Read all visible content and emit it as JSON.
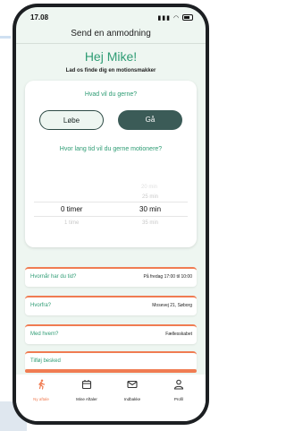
{
  "status": {
    "time": "17.08"
  },
  "header": {
    "title": "Send en anmodning"
  },
  "greeting": "Hej Mike!",
  "subtitle": "Lad os finde dig en motionsmakker",
  "activity": {
    "question": "Hvad vil du gerne?",
    "options": [
      "Løbe",
      "Gå"
    ],
    "selected": "Gå"
  },
  "duration": {
    "question": "Hvor lang tid vil du gerne motionere?",
    "hours": {
      "above": "",
      "selected": "0 timer",
      "below": "1 time"
    },
    "minutes": {
      "above2": "20 min",
      "above1": "25 min",
      "selected": "30 min",
      "below": "35 min"
    }
  },
  "rows": [
    {
      "label": "Hvornår har du tid?",
      "value": "På fredag 17:00 til 10:00"
    },
    {
      "label": "Hvorfra?",
      "value": "Mosevej 21, Søborg"
    },
    {
      "label": "Med hvem?",
      "value": "Fællesskabet"
    },
    {
      "label": "Tilføj besked",
      "value": ""
    }
  ],
  "tabs": [
    {
      "label": "Ny aftale",
      "icon": "runner-icon",
      "active": true
    },
    {
      "label": "Mine Aftaler",
      "icon": "calendar-icon",
      "active": false
    },
    {
      "label": "Indbakke",
      "icon": "mail-icon",
      "active": false
    },
    {
      "label": "Profil",
      "icon": "person-icon",
      "active": false
    }
  ],
  "colors": {
    "accent": "#2e9c74",
    "orange": "#f07c52",
    "button_dark": "#3b5b57"
  }
}
